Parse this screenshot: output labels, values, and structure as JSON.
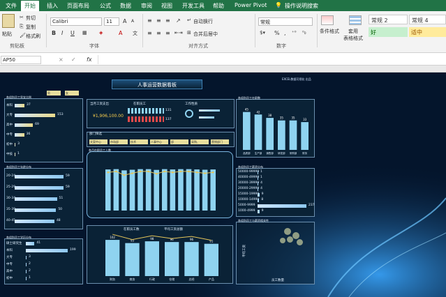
{
  "ribbon_tabs": [
    "文件",
    "开始",
    "插入",
    "页面布局",
    "公式",
    "数据",
    "审阅",
    "视图",
    "开发工具",
    "帮助",
    "Power Pivot",
    "操作说明搜索"
  ],
  "clipboard": {
    "paste": "粘贴",
    "cut": "剪切",
    "copy": "复制",
    "format_painter": "格式刷",
    "group": "剪贴板"
  },
  "font": {
    "name": "Calibri",
    "size": "11",
    "bold": "B",
    "italic": "I",
    "underline": "U",
    "grow": "A",
    "shrink": "A",
    "group": "字体"
  },
  "alignment": {
    "wrap": "自动换行",
    "merge": "合并后居中",
    "group": "对齐方式"
  },
  "number": {
    "format": "常规",
    "percent": "%",
    "comma": ",",
    "group": "数字"
  },
  "styles": {
    "conditional": "条件格式",
    "table_fmt": "套用\n表格格式",
    "cell_styles": [
      "常规 2",
      "常规 4",
      "好",
      "适中"
    ]
  },
  "formula_bar": {
    "name_box": "AP50",
    "cancel": "×",
    "enter": "✓",
    "fx": "fx",
    "content": ""
  },
  "dashboard": {
    "title": "人事运营数据看板",
    "logo": "EXCEL数据可视化 出品",
    "gender_panel": {
      "title": "各组别员工男女比例",
      "tabs": [
        "男",
        "女"
      ],
      "rows": [
        {
          "name": "本科",
          "value": "37"
        },
        {
          "name": "大专",
          "value": "153"
        },
        {
          "name": "高中",
          "value": "69"
        },
        {
          "name": "中专",
          "value": "36"
        },
        {
          "name": "初中",
          "value": "3"
        },
        {
          "name": "中技",
          "value": "1"
        }
      ]
    },
    "summary": {
      "payroll_label": "当月工资支出",
      "payroll": "¥1,906,100.00",
      "staff_label": "在职员工",
      "staff_a": "131",
      "staff_b": "137",
      "tenure_label": "工作性质",
      "ratio": ""
    },
    "filters": {
      "title": "部门筛选",
      "items": [
        "文案中心",
        "市场部",
        "技术",
        "人事中心",
        "部",
        "采购、",
        "营销部门"
      ]
    },
    "age_panel": {
      "title": "各组别员工年龄分布",
      "rows": [
        {
          "name": "20-24",
          "value": "59"
        },
        {
          "name": "25-29",
          "value": "59"
        },
        {
          "name": "30-34",
          "value": "51"
        },
        {
          "name": "35-39",
          "value": "50"
        },
        {
          "name": "40-45",
          "value": "48"
        }
      ]
    },
    "center_chart": {
      "title": "各月在职员工人数",
      "values": [
        268,
        270,
        262,
        266,
        270,
        270,
        265,
        270,
        268,
        270,
        270,
        268,
        266,
        268
      ]
    },
    "edu_panel": {
      "title": "各组别员工学历分布",
      "rows": [
        {
          "name": "硕士研究生",
          "value": "41"
        },
        {
          "name": "本科",
          "value": "199"
        },
        {
          "name": "大专",
          "value": "3"
        },
        {
          "name": "中专",
          "value": "2"
        },
        {
          "name": "高中",
          "value": "2"
        },
        {
          "name": "初中",
          "value": "1"
        }
      ]
    },
    "bottom_chart": {
      "legend": [
        "在职员工数",
        "平均工资总额"
      ],
      "categories": [
        "财务",
        "商务",
        "行政",
        "仓储",
        "总经",
        "产品"
      ],
      "values": [
        "102",
        "93",
        "98",
        "96",
        "96",
        "91"
      ]
    },
    "right_top": {
      "title": "各组别员工在职数",
      "values": [
        "45",
        "42",
        "38",
        "35",
        "35",
        "33"
      ],
      "categories": [
        "品质部",
        "生产部",
        "销售部",
        "研发部",
        "采购部",
        "财务"
      ]
    },
    "salary_panel": {
      "title": "各组别员工薪资分布",
      "rows": [
        {
          "name": "50000-99999",
          "value": "1"
        },
        {
          "name": "40000-49999",
          "value": "1"
        },
        {
          "name": "30000-39999",
          "value": "4"
        },
        {
          "name": "20000-29999",
          "value": "4"
        },
        {
          "name": "15000-19999",
          "value": "9"
        },
        {
          "name": "10000-14999",
          "value": "8"
        },
        {
          "name": "5000-9999",
          "value": "237"
        },
        {
          "name": "1000-4999",
          "value": "9"
        }
      ]
    },
    "scatter_panel": {
      "title": "各组别员工与薪资相关性",
      "xlabel": "员工数量",
      "ylabel": "平均工资"
    }
  }
}
